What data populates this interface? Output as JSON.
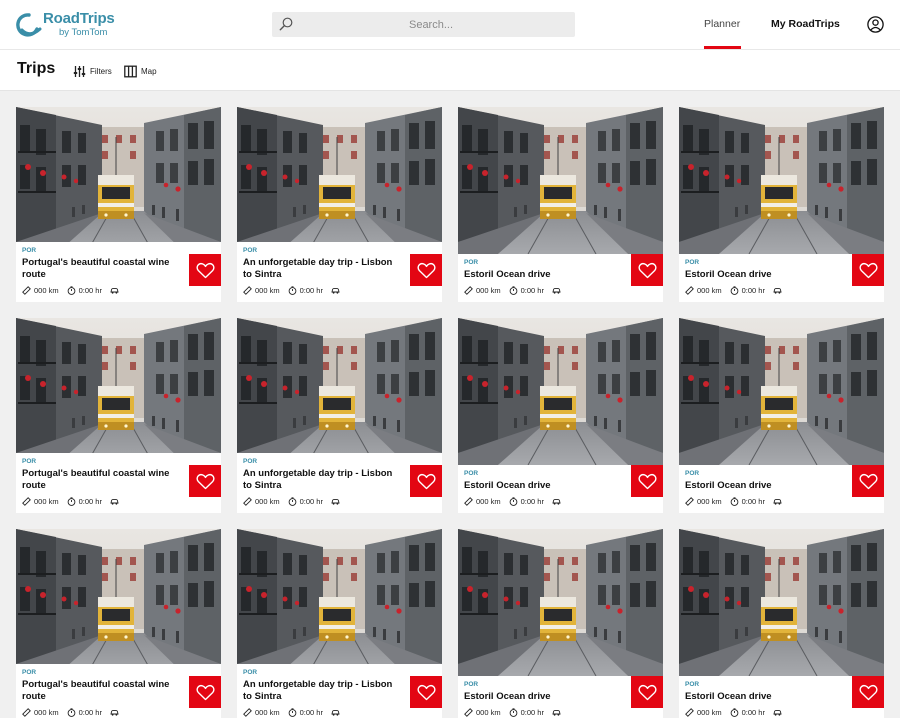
{
  "header": {
    "logo_title": "RoadTrips",
    "logo_subtitle": "by TomTom",
    "search_placeholder": "Search...",
    "nav_planner": "Planner",
    "nav_my_roadtrips": "My RoadTrips"
  },
  "toolbar": {
    "page_title": "Trips",
    "filters_label": "Filters",
    "map_label": "Map"
  },
  "colors": {
    "brand": "#3a8ea8",
    "accent_red": "#e30613"
  },
  "trips": [
    {
      "country": "POR",
      "title": "Portugal's beautiful coastal wine route",
      "distance": "000 km",
      "duration": "0:00 hr",
      "favorited": true
    },
    {
      "country": "POR",
      "title": "An unforgetable day trip - Lisbon to Sintra",
      "distance": "000 km",
      "duration": "0:00 hr",
      "favorited": true
    },
    {
      "country": "POR",
      "title": "Estoril Ocean drive",
      "distance": "000 km",
      "duration": "0:00 hr",
      "favorited": true
    },
    {
      "country": "POR",
      "title": "Estoril Ocean drive",
      "distance": "000 km",
      "duration": "0:00 hr",
      "favorited": true
    },
    {
      "country": "POR",
      "title": "Portugal's beautiful coastal wine route",
      "distance": "000 km",
      "duration": "0:00 hr",
      "favorited": true
    },
    {
      "country": "POR",
      "title": "An unforgetable day trip - Lisbon to Sintra",
      "distance": "000 km",
      "duration": "0:00 hr",
      "favorited": true
    },
    {
      "country": "POR",
      "title": "Estoril Ocean drive",
      "distance": "000 km",
      "duration": "0:00 hr",
      "favorited": true
    },
    {
      "country": "POR",
      "title": "Estoril Ocean drive",
      "distance": "000 km",
      "duration": "0:00 hr",
      "favorited": true
    },
    {
      "country": "POR",
      "title": "Portugal's beautiful coastal wine route",
      "distance": "000 km",
      "duration": "0:00 hr",
      "favorited": true
    },
    {
      "country": "POR",
      "title": "An unforgetable day trip - Lisbon to Sintra",
      "distance": "000 km",
      "duration": "0:00 hr",
      "favorited": true
    },
    {
      "country": "POR",
      "title": "Estoril Ocean drive",
      "distance": "000 km",
      "duration": "0:00 hr",
      "favorited": true
    },
    {
      "country": "POR",
      "title": "Estoril Ocean drive",
      "distance": "000 km",
      "duration": "0:00 hr",
      "favorited": true
    }
  ]
}
